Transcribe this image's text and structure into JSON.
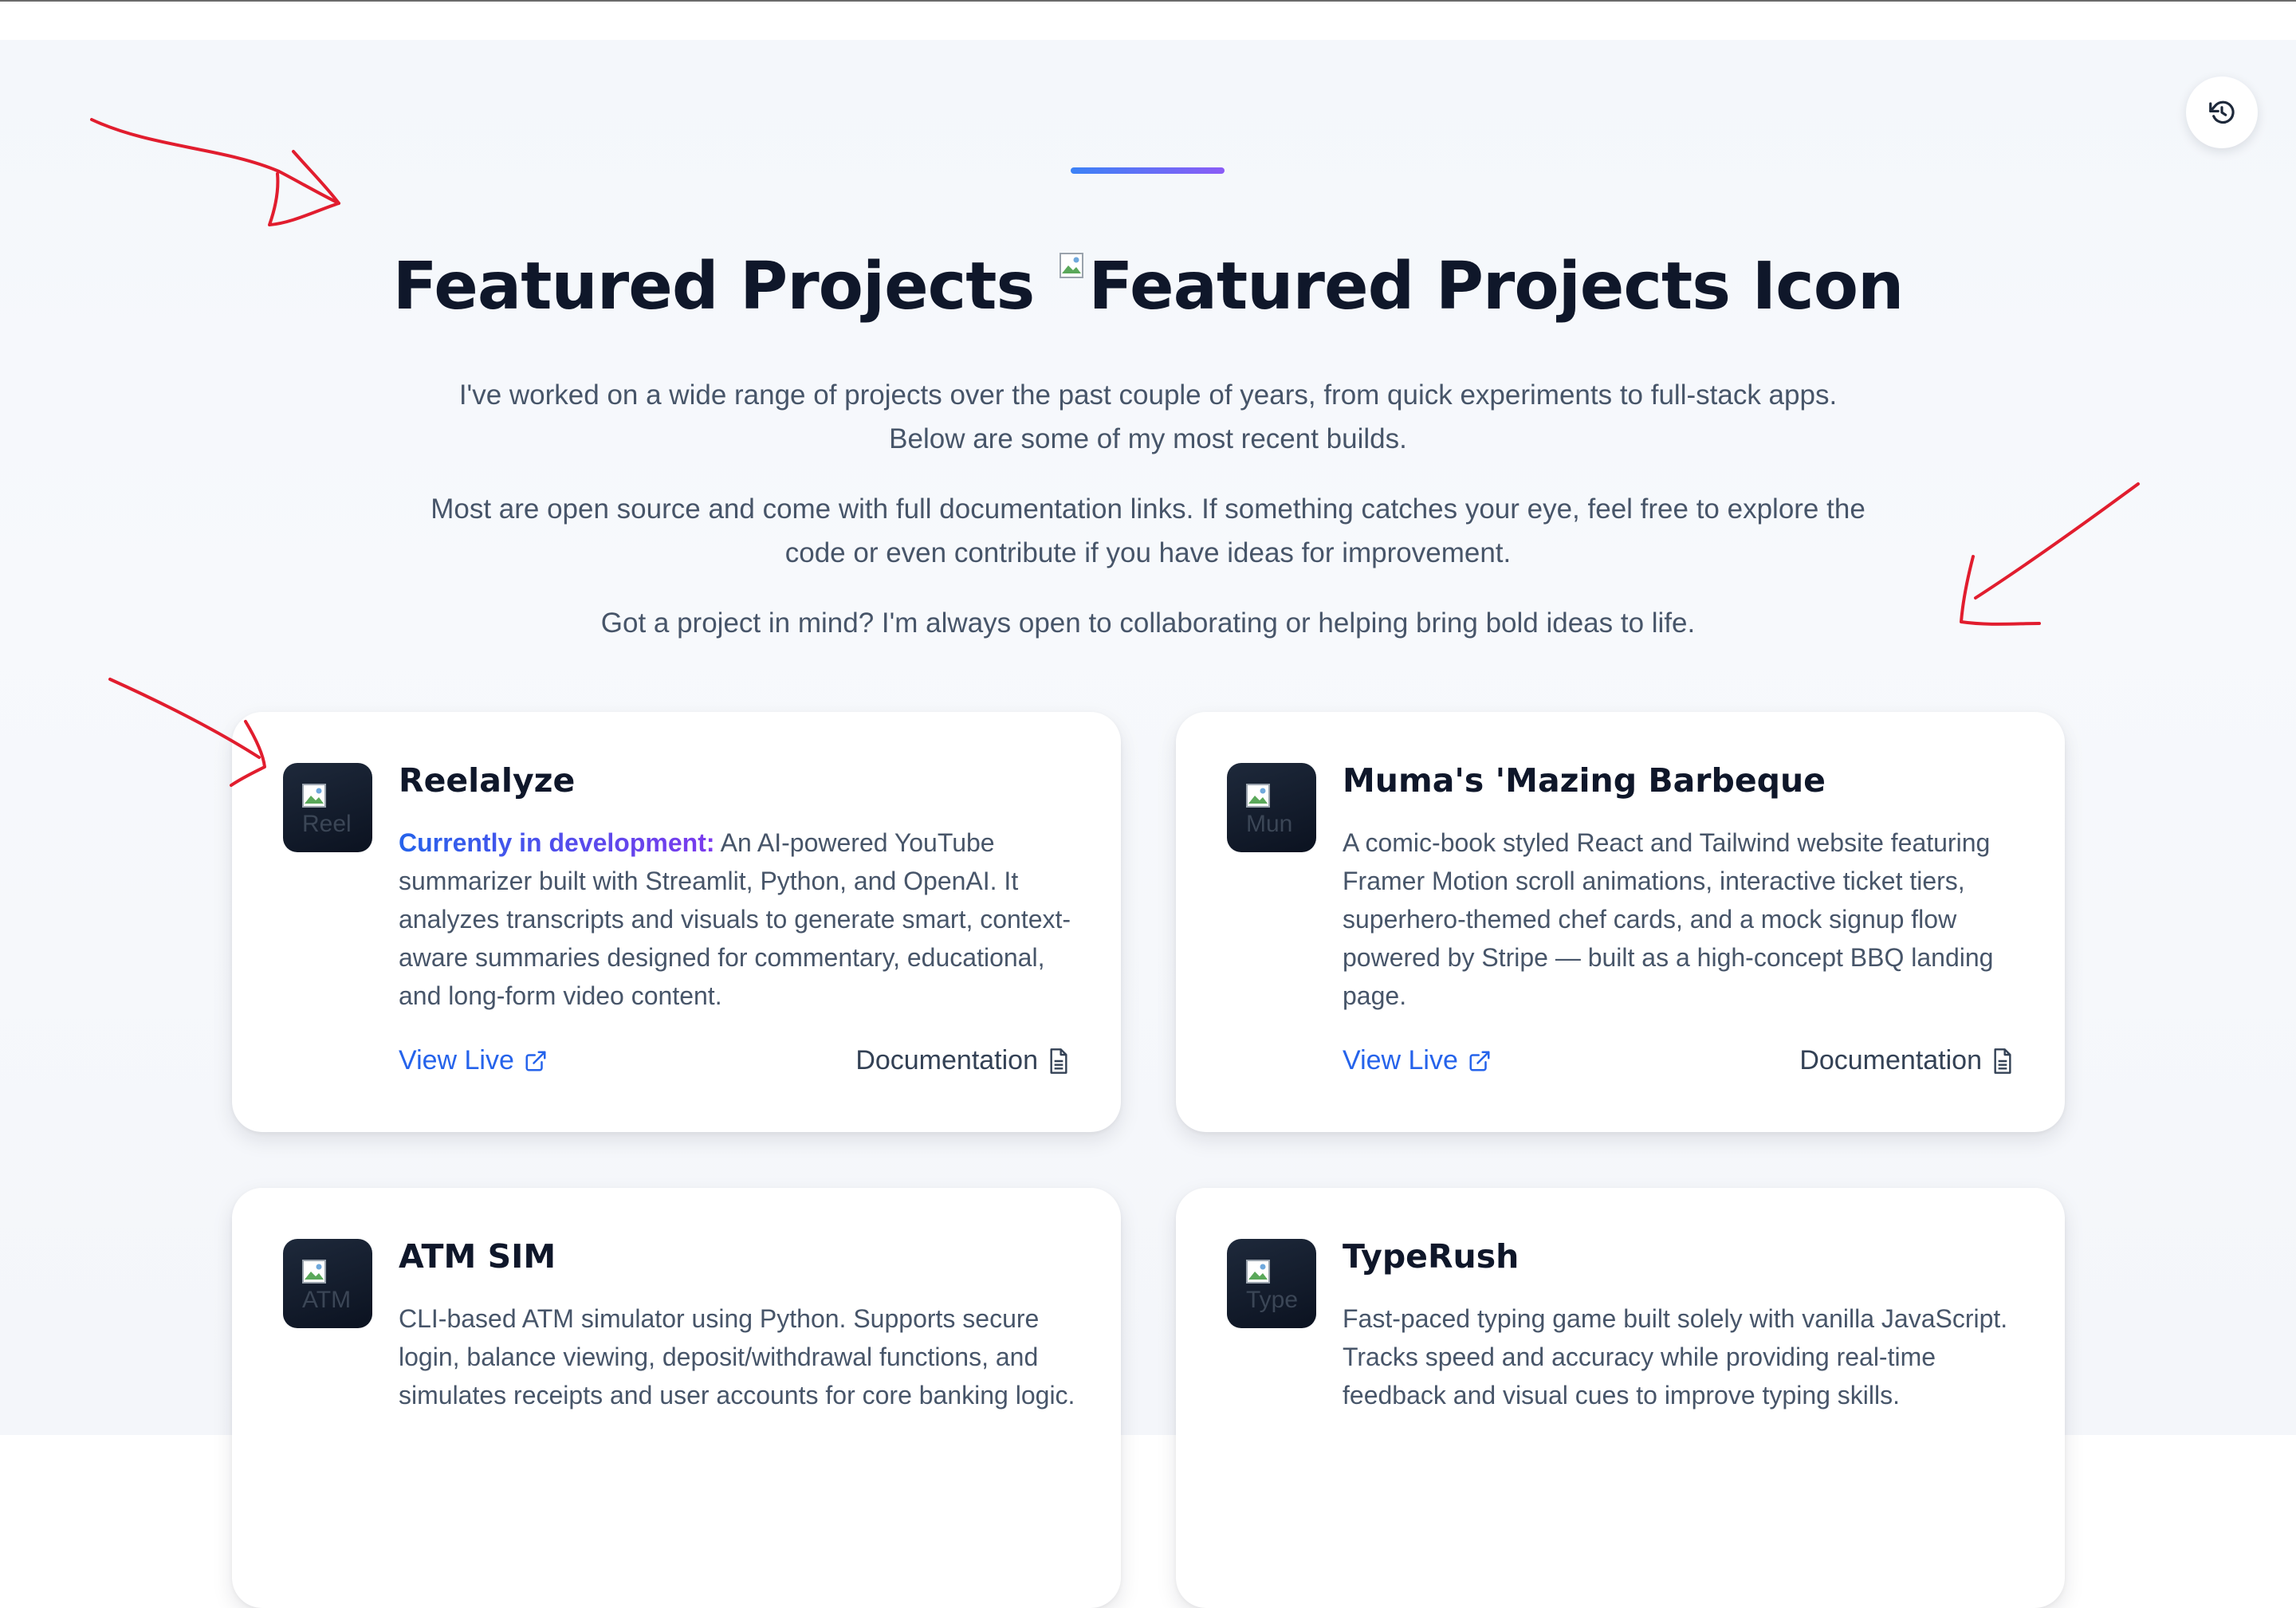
{
  "header": {
    "title": "Featured Projects",
    "title_icon_alt": "Featured Projects Icon"
  },
  "intro": {
    "paragraphs": [
      "I've worked on a wide range of projects over the past couple of years, from quick experiments to full-stack apps. Below are some of my most recent builds.",
      "Most are open source and come with full documentation links. If something catches your eye, feel free to explore the code or even contribute if you have ideas for improvement.",
      "Got a project in mind? I'm always open to collaborating or helping bring bold ideas to life."
    ]
  },
  "projects": [
    {
      "name": "Reelalyze",
      "thumb_alt": "Reel",
      "status": "Currently in development:",
      "description": "An AI-powered YouTube summarizer built with Streamlit, Python, and OpenAI. It analyzes transcripts and visuals to generate smart, context-aware summaries designed for commentary, educational, and long-form video content.",
      "live_label": "View Live",
      "doc_label": "Documentation"
    },
    {
      "name": "Muma's 'Mazing Barbeque",
      "thumb_alt": "Mun",
      "description": "A comic-book styled React and Tailwind website featuring Framer Motion scroll animations, interactive ticket tiers, superhero-themed chef cards, and a mock signup flow powered by Stripe — built as a high-concept BBQ landing page.",
      "live_label": "View Live",
      "doc_label": "Documentation"
    },
    {
      "name": "ATM SIM",
      "thumb_alt": "ATM",
      "description": "CLI-based ATM simulator using Python. Supports secure login, balance viewing, deposit/withdrawal functions, and simulates receipts and user accounts for core banking logic."
    },
    {
      "name": "TypeRush",
      "thumb_alt": "Type",
      "description": "Fast-paced typing game built solely with vanilla JavaScript. Tracks speed and accuracy while providing real-time feedback and visual cues to improve typing skills."
    }
  ],
  "icons": {
    "undo": "undo-icon",
    "external_link": "external-link-icon",
    "document": "document-icon",
    "broken_image": "broken-image-icon"
  },
  "colors": {
    "accent_blue": "#2563eb",
    "accent_purple": "#8b5cf6",
    "annotation_red": "#e11d2e",
    "heading": "#0f172a",
    "body_text": "#475569"
  }
}
